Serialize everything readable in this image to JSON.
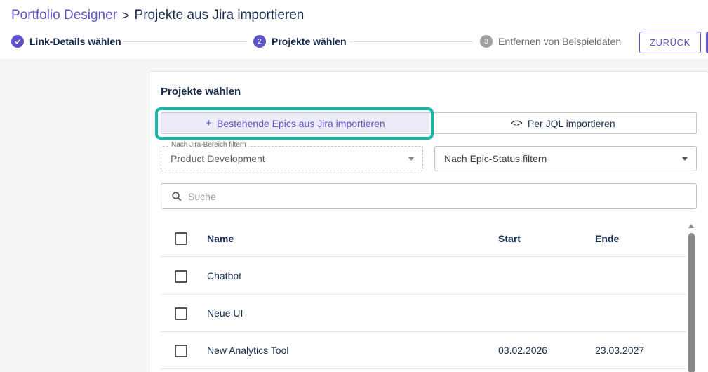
{
  "breadcrumb": {
    "parent": "Portfolio Designer",
    "separator": ">",
    "current": "Projekte aus Jira importieren"
  },
  "stepper": {
    "steps": [
      {
        "number": "",
        "label": "Link-Details wählen",
        "state": "done"
      },
      {
        "number": "2",
        "label": "Projekte wählen",
        "state": "active"
      },
      {
        "number": "3",
        "label": "Entfernen von Beispieldaten",
        "state": "todo"
      }
    ]
  },
  "actions": {
    "back_label": "ZURÜCK"
  },
  "card": {
    "title": "Projekte wählen"
  },
  "import_mode": {
    "existing_epics": "Bestehende Epics aus Jira importieren",
    "existing_icon": "+",
    "jql": "Per JQL importieren",
    "jql_icon": "<>"
  },
  "filters": {
    "area_legend": "Nach Jira-Bereich filtern",
    "area_value": "Product Development",
    "status_placeholder": "Nach Epic-Status filtern"
  },
  "search": {
    "placeholder": "Suche"
  },
  "table": {
    "headers": {
      "name": "Name",
      "start": "Start",
      "end": "Ende"
    },
    "rows": [
      {
        "name": "Chatbot",
        "start": "",
        "end": ""
      },
      {
        "name": "Neue UI",
        "start": "",
        "end": ""
      },
      {
        "name": "New Analytics Tool",
        "start": "03.02.2026",
        "end": "23.03.2027"
      }
    ]
  },
  "colors": {
    "accent": "#5e54c7",
    "highlight": "#14b6a8"
  }
}
